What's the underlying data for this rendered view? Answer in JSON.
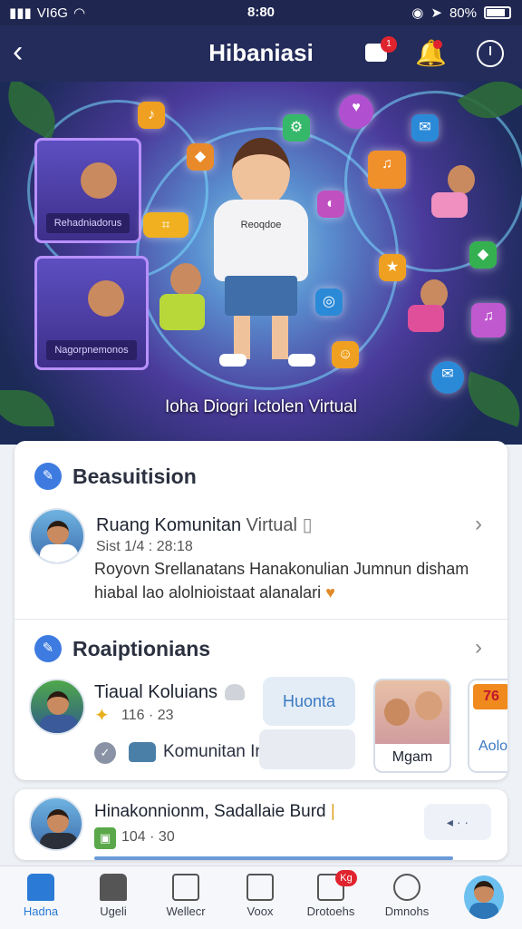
{
  "status_bar": {
    "carrier": "VI6G",
    "time": "8:80",
    "battery": "80%"
  },
  "header": {
    "back_icon": "‹",
    "title": "Hibaniasi",
    "chat_badge": "1"
  },
  "hero": {
    "caption": "Ioha Diogri Ictolen Virtual",
    "shirt_text": "Reoqdoe",
    "screen1_label": "Rehadniadorus",
    "screen2_label": "Nagorpnemonos"
  },
  "section1": {
    "heading": "Beasuitision",
    "item": {
      "title": "Ruang Komunitan",
      "title_suffix": "Virtual",
      "meta": "Sist 1/4 : 28:18",
      "description": "Royovn Srellanatans Hanakonulian Jumnun disham hiabal lao alolnioistaat alanalari"
    }
  },
  "section2": {
    "heading": "Roaiptionians",
    "item": {
      "title": "Tiaual Koluians",
      "stat": "116 · 23",
      "button1": "Huonta",
      "button2": "Komunitan Inelsiaal",
      "photo_caption": "Mgam",
      "partial_tag": "76",
      "partial_text": "Aolo"
    }
  },
  "section3": {
    "title": "Hinakonnionm, Sadallaie Burd",
    "stat": "104 · 30",
    "action": "◂ · ·"
  },
  "tabs": [
    {
      "label": "Hadna",
      "active": true
    },
    {
      "label": "Ugeli",
      "active": false
    },
    {
      "label": "Wellecr",
      "active": false
    },
    {
      "label": "Voox",
      "active": false
    },
    {
      "label": "Drotoehs",
      "active": false,
      "badge": "Kg"
    },
    {
      "label": "Dmnohs",
      "active": false
    }
  ]
}
